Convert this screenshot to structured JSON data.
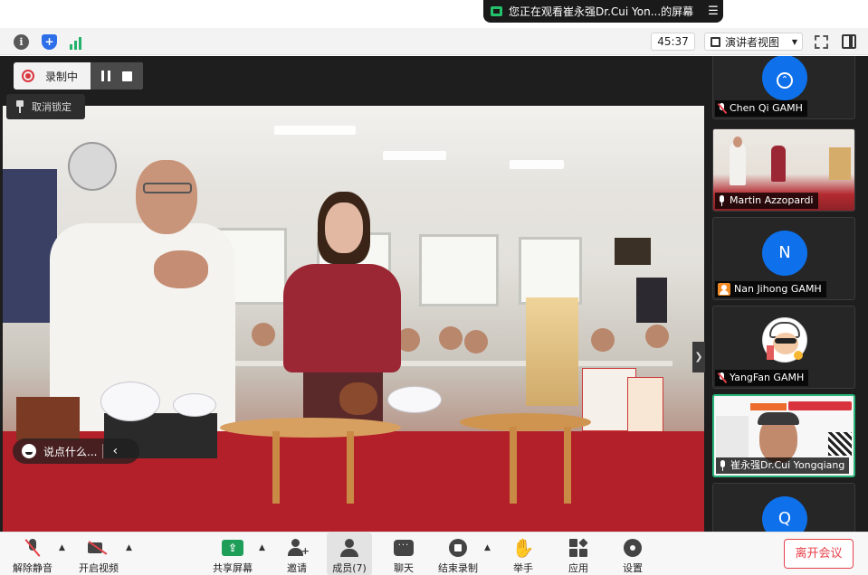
{
  "banner": {
    "text": "您正在观看崔永强Dr.Cui Yon...的屏幕"
  },
  "toolbar": {
    "timer": "45:37",
    "view_label": "演讲者视图"
  },
  "recording": {
    "label": "录制中",
    "unpin_label": "取消锁定"
  },
  "chat": {
    "placeholder": "说点什么..."
  },
  "gallery": {
    "tiles": [
      {
        "name": "Chen Qi GAMH",
        "avatar_text": "",
        "mic": "muted"
      },
      {
        "name": "Martin Azzopardi",
        "avatar_text": "",
        "mic": "on"
      },
      {
        "name": "Nan Jihong GAMH",
        "avatar_text": "N",
        "mic": "none"
      },
      {
        "name": "YangFan GAMH",
        "avatar_text": "",
        "mic": "muted"
      },
      {
        "name": "崔永强Dr.Cui Yongqiang",
        "avatar_text": "",
        "mic": "on",
        "active": true
      },
      {
        "name": "",
        "avatar_text": "Q",
        "mic": "none"
      }
    ]
  },
  "bottombar": {
    "mute": "解除静音",
    "video": "开启视频",
    "share": "共享屏幕",
    "invite": "邀请",
    "participants": "成员(7)",
    "chat": "聊天",
    "stop_record": "结束录制",
    "raise_hand": "举手",
    "apps": "应用",
    "settings": "设置",
    "leave": "离开会议"
  },
  "colors": {
    "accent_green": "#2ab67a",
    "leave_red": "#e5424b",
    "avatar_blue": "#0e71eb"
  }
}
